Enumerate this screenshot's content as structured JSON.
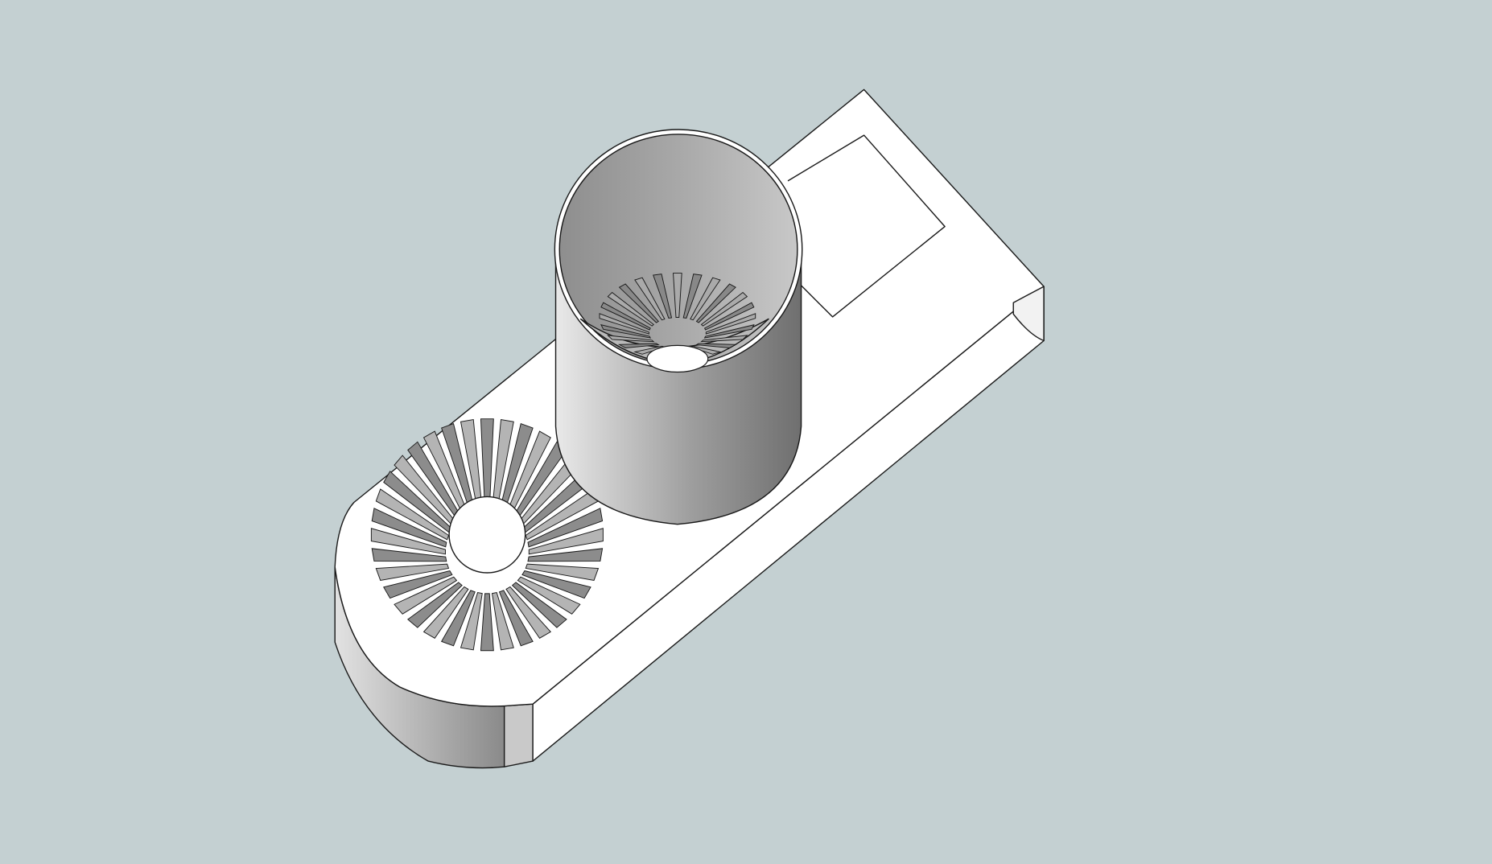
{
  "viewport": {
    "background": "#c4d0d2",
    "edge_color": "#1a1a1a"
  },
  "model": {
    "subject": "3d-model-fan-housing",
    "base_color": "#ffffff",
    "shaded_light": "#e6e6e6",
    "shaded_dark": "#7d7d7d",
    "glass_tint": "#dde3f4",
    "fan_blade_count": 36,
    "inner_fan_blade_count": 24
  }
}
